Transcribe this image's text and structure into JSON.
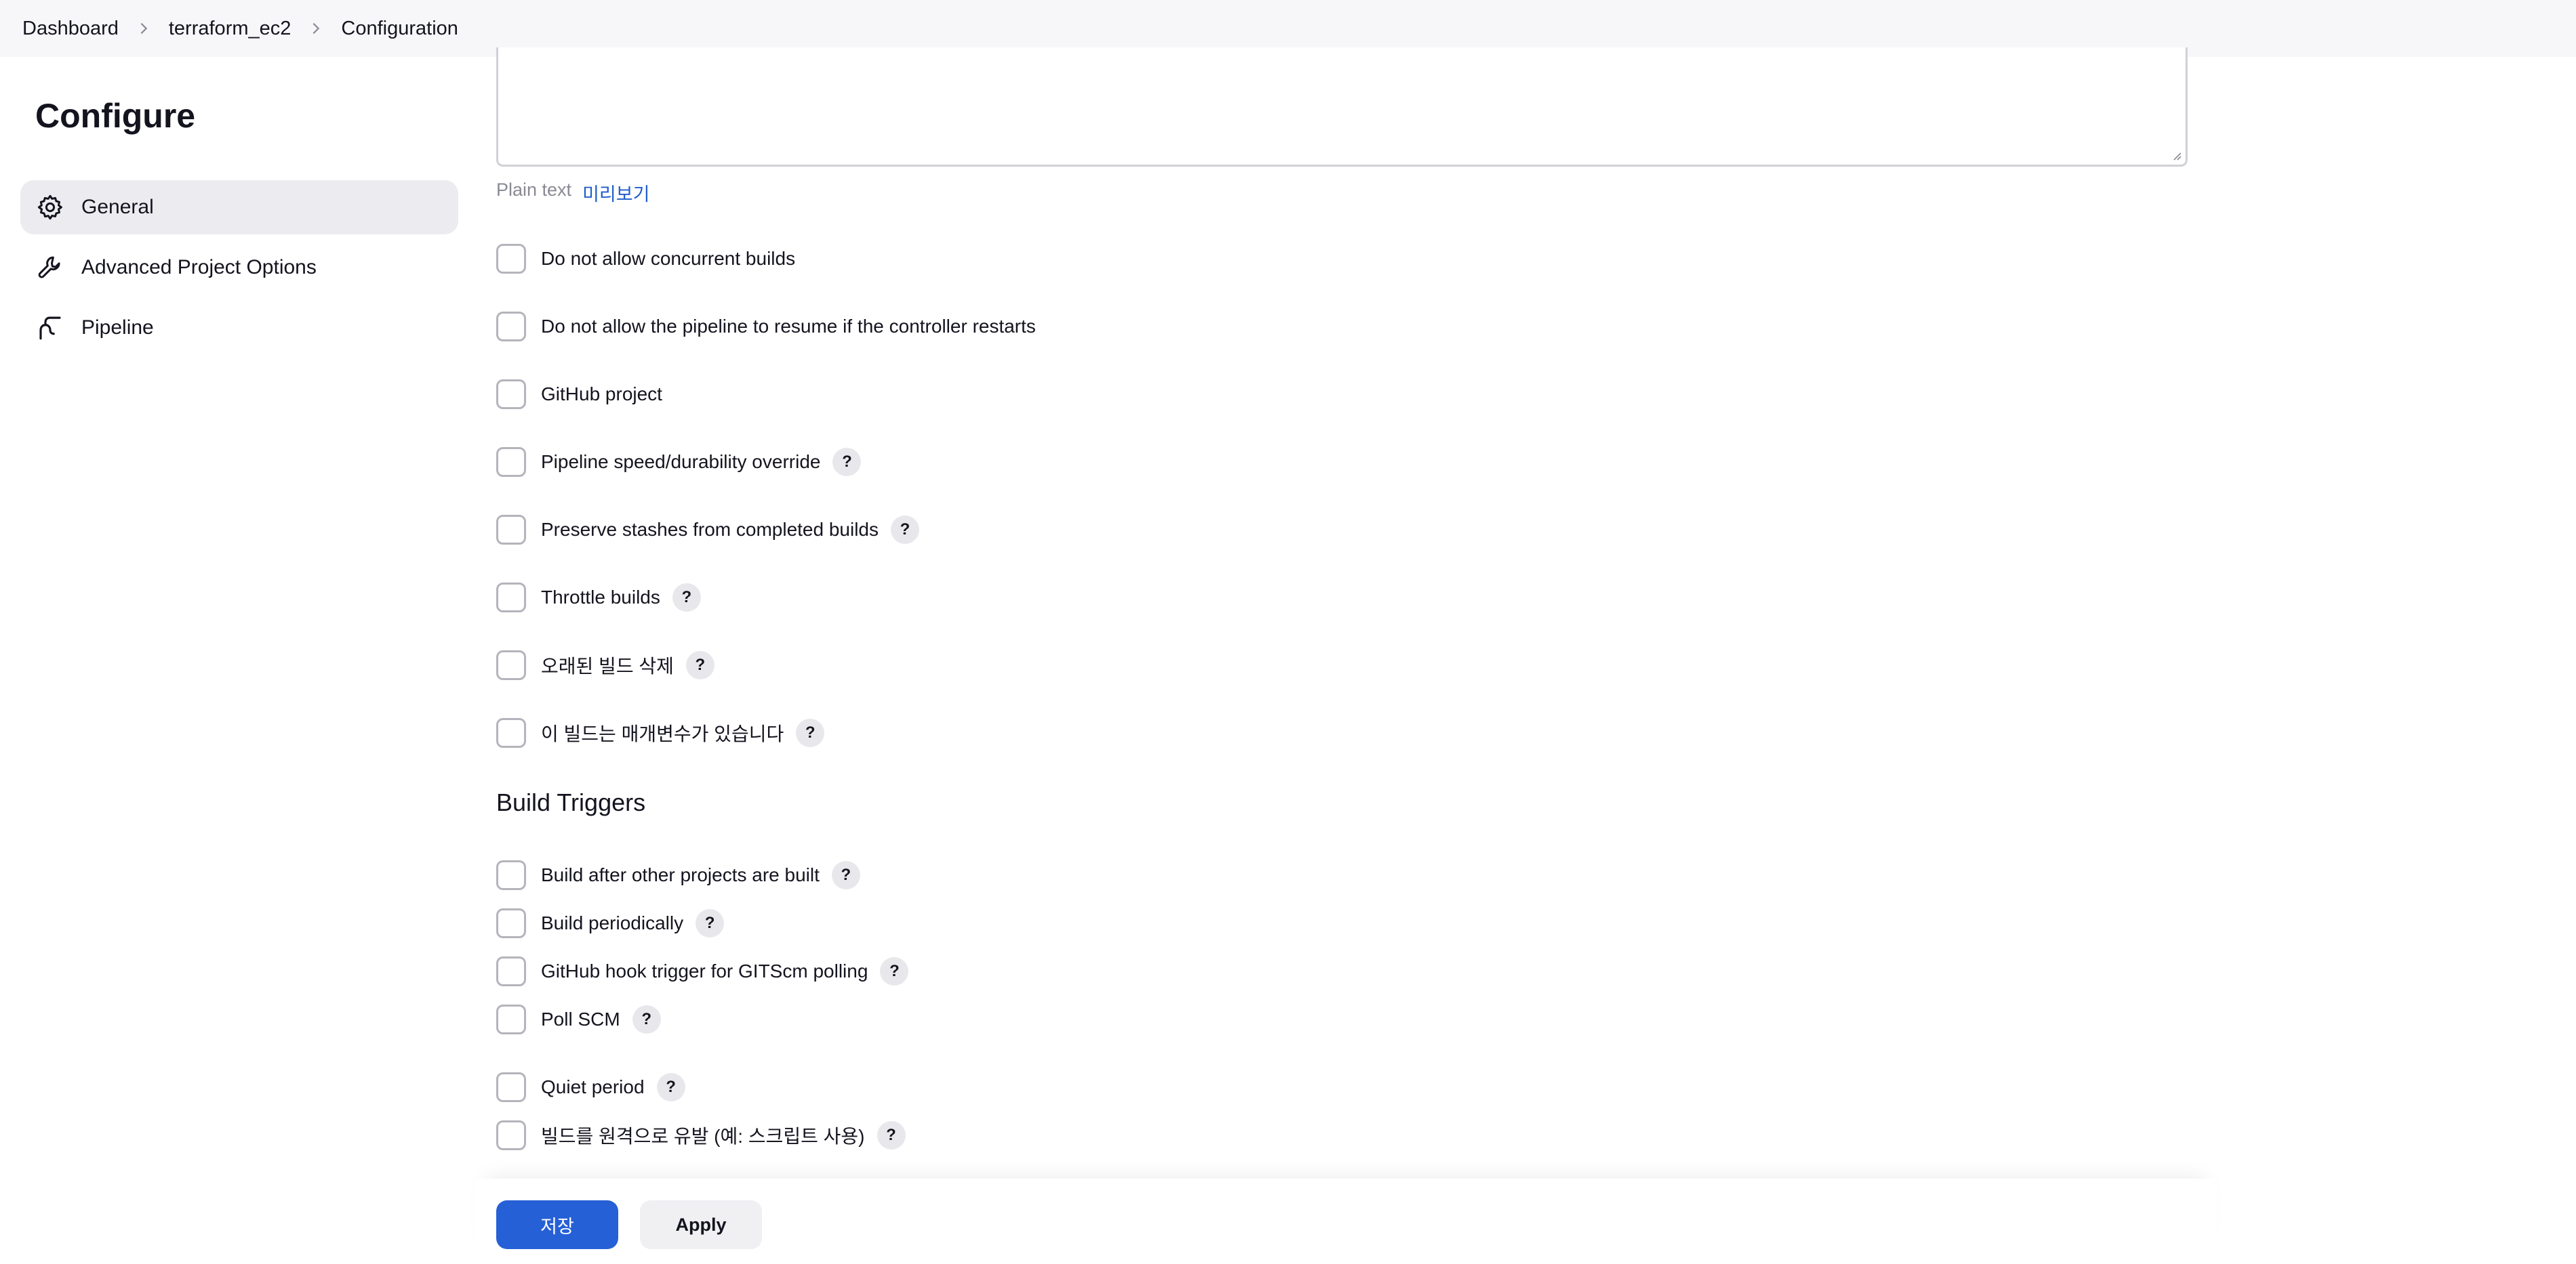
{
  "breadcrumb": {
    "items": [
      "Dashboard",
      "terraform_ec2",
      "Configuration"
    ]
  },
  "sidebar": {
    "title": "Configure",
    "items": [
      {
        "label": "General",
        "icon": "gear-icon",
        "active": true
      },
      {
        "label": "Advanced Project Options",
        "icon": "wrench-icon",
        "active": false
      },
      {
        "label": "Pipeline",
        "icon": "pipeline-icon",
        "active": false
      }
    ]
  },
  "description": {
    "format_label": "Plain text",
    "preview_label": "미리보기"
  },
  "general_options": [
    {
      "label": "Do not allow concurrent builds",
      "help": false
    },
    {
      "label": "Do not allow the pipeline to resume if the controller restarts",
      "help": false
    },
    {
      "label": "GitHub project",
      "help": false
    },
    {
      "label": "Pipeline speed/durability override",
      "help": true
    },
    {
      "label": "Preserve stashes from completed builds",
      "help": true
    },
    {
      "label": "Throttle builds",
      "help": true
    },
    {
      "label": "오래된 빌드 삭제",
      "help": true
    },
    {
      "label": "이 빌드는 매개변수가 있습니다",
      "help": true
    }
  ],
  "build_triggers": {
    "title": "Build Triggers",
    "options": [
      {
        "label": "Build after other projects are built",
        "help": true
      },
      {
        "label": "Build periodically",
        "help": true
      },
      {
        "label": "GitHub hook trigger for GITScm polling",
        "help": true
      },
      {
        "label": "Poll SCM",
        "help": true
      },
      {
        "label": "Quiet period",
        "help": true
      },
      {
        "label": "빌드를 원격으로 유발 (예: 스크립트 사용)",
        "help": true
      }
    ]
  },
  "help_glyph": "?",
  "buttons": {
    "save_label": "저장",
    "apply_label": "Apply"
  },
  "colors": {
    "primary": "#2660d6",
    "link": "#1f5ecc",
    "active_nav": "#ececf0"
  }
}
